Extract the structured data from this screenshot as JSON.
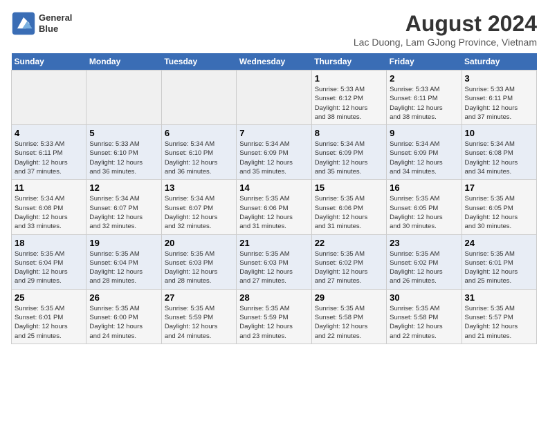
{
  "header": {
    "logo_line1": "General",
    "logo_line2": "Blue",
    "title": "August 2024",
    "subtitle": "Lac Duong, Lam GJong Province, Vietnam"
  },
  "days_of_week": [
    "Sunday",
    "Monday",
    "Tuesday",
    "Wednesday",
    "Thursday",
    "Friday",
    "Saturday"
  ],
  "weeks": [
    [
      {
        "day": "",
        "info": ""
      },
      {
        "day": "",
        "info": ""
      },
      {
        "day": "",
        "info": ""
      },
      {
        "day": "",
        "info": ""
      },
      {
        "day": "1",
        "info": "Sunrise: 5:33 AM\nSunset: 6:12 PM\nDaylight: 12 hours\nand 38 minutes."
      },
      {
        "day": "2",
        "info": "Sunrise: 5:33 AM\nSunset: 6:11 PM\nDaylight: 12 hours\nand 38 minutes."
      },
      {
        "day": "3",
        "info": "Sunrise: 5:33 AM\nSunset: 6:11 PM\nDaylight: 12 hours\nand 37 minutes."
      }
    ],
    [
      {
        "day": "4",
        "info": "Sunrise: 5:33 AM\nSunset: 6:11 PM\nDaylight: 12 hours\nand 37 minutes."
      },
      {
        "day": "5",
        "info": "Sunrise: 5:33 AM\nSunset: 6:10 PM\nDaylight: 12 hours\nand 36 minutes."
      },
      {
        "day": "6",
        "info": "Sunrise: 5:34 AM\nSunset: 6:10 PM\nDaylight: 12 hours\nand 36 minutes."
      },
      {
        "day": "7",
        "info": "Sunrise: 5:34 AM\nSunset: 6:09 PM\nDaylight: 12 hours\nand 35 minutes."
      },
      {
        "day": "8",
        "info": "Sunrise: 5:34 AM\nSunset: 6:09 PM\nDaylight: 12 hours\nand 35 minutes."
      },
      {
        "day": "9",
        "info": "Sunrise: 5:34 AM\nSunset: 6:09 PM\nDaylight: 12 hours\nand 34 minutes."
      },
      {
        "day": "10",
        "info": "Sunrise: 5:34 AM\nSunset: 6:08 PM\nDaylight: 12 hours\nand 34 minutes."
      }
    ],
    [
      {
        "day": "11",
        "info": "Sunrise: 5:34 AM\nSunset: 6:08 PM\nDaylight: 12 hours\nand 33 minutes."
      },
      {
        "day": "12",
        "info": "Sunrise: 5:34 AM\nSunset: 6:07 PM\nDaylight: 12 hours\nand 32 minutes."
      },
      {
        "day": "13",
        "info": "Sunrise: 5:34 AM\nSunset: 6:07 PM\nDaylight: 12 hours\nand 32 minutes."
      },
      {
        "day": "14",
        "info": "Sunrise: 5:35 AM\nSunset: 6:06 PM\nDaylight: 12 hours\nand 31 minutes."
      },
      {
        "day": "15",
        "info": "Sunrise: 5:35 AM\nSunset: 6:06 PM\nDaylight: 12 hours\nand 31 minutes."
      },
      {
        "day": "16",
        "info": "Sunrise: 5:35 AM\nSunset: 6:05 PM\nDaylight: 12 hours\nand 30 minutes."
      },
      {
        "day": "17",
        "info": "Sunrise: 5:35 AM\nSunset: 6:05 PM\nDaylight: 12 hours\nand 30 minutes."
      }
    ],
    [
      {
        "day": "18",
        "info": "Sunrise: 5:35 AM\nSunset: 6:04 PM\nDaylight: 12 hours\nand 29 minutes."
      },
      {
        "day": "19",
        "info": "Sunrise: 5:35 AM\nSunset: 6:04 PM\nDaylight: 12 hours\nand 28 minutes."
      },
      {
        "day": "20",
        "info": "Sunrise: 5:35 AM\nSunset: 6:03 PM\nDaylight: 12 hours\nand 28 minutes."
      },
      {
        "day": "21",
        "info": "Sunrise: 5:35 AM\nSunset: 6:03 PM\nDaylight: 12 hours\nand 27 minutes."
      },
      {
        "day": "22",
        "info": "Sunrise: 5:35 AM\nSunset: 6:02 PM\nDaylight: 12 hours\nand 27 minutes."
      },
      {
        "day": "23",
        "info": "Sunrise: 5:35 AM\nSunset: 6:02 PM\nDaylight: 12 hours\nand 26 minutes."
      },
      {
        "day": "24",
        "info": "Sunrise: 5:35 AM\nSunset: 6:01 PM\nDaylight: 12 hours\nand 25 minutes."
      }
    ],
    [
      {
        "day": "25",
        "info": "Sunrise: 5:35 AM\nSunset: 6:01 PM\nDaylight: 12 hours\nand 25 minutes."
      },
      {
        "day": "26",
        "info": "Sunrise: 5:35 AM\nSunset: 6:00 PM\nDaylight: 12 hours\nand 24 minutes."
      },
      {
        "day": "27",
        "info": "Sunrise: 5:35 AM\nSunset: 5:59 PM\nDaylight: 12 hours\nand 24 minutes."
      },
      {
        "day": "28",
        "info": "Sunrise: 5:35 AM\nSunset: 5:59 PM\nDaylight: 12 hours\nand 23 minutes."
      },
      {
        "day": "29",
        "info": "Sunrise: 5:35 AM\nSunset: 5:58 PM\nDaylight: 12 hours\nand 22 minutes."
      },
      {
        "day": "30",
        "info": "Sunrise: 5:35 AM\nSunset: 5:58 PM\nDaylight: 12 hours\nand 22 minutes."
      },
      {
        "day": "31",
        "info": "Sunrise: 5:35 AM\nSunset: 5:57 PM\nDaylight: 12 hours\nand 21 minutes."
      }
    ]
  ]
}
